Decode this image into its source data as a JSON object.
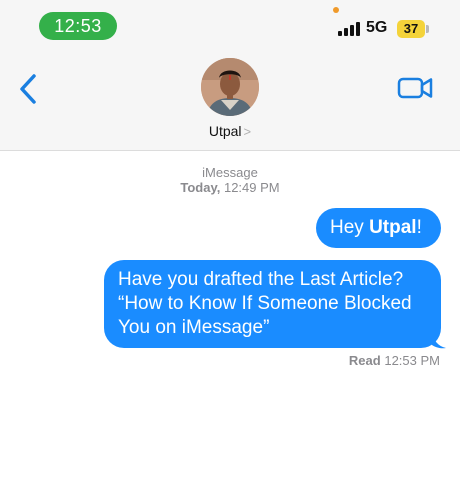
{
  "status_bar": {
    "time": "12:53",
    "network": "5G",
    "battery": "37"
  },
  "nav": {
    "contact_name": "Utpal",
    "chevron": ">"
  },
  "conversation": {
    "service": "iMessage",
    "timestamp_day": "Today,",
    "timestamp_time": "12:49 PM",
    "messages": [
      {
        "prefix": "Hey ",
        "bold": "Utpal",
        "suffix": "!"
      },
      {
        "text": "Have you drafted the Last Article? “How to Know If Someone Blocked You on iMessage”"
      }
    ],
    "read_label": "Read",
    "read_time": "12:53 PM"
  },
  "colors": {
    "bubble": "#1a8cff",
    "accent": "#1a8cff",
    "time_pill": "#34b04a",
    "battery": "#f4d33a"
  },
  "icons": [
    "back-chevron-icon",
    "video-camera-icon",
    "signal-bars-icon",
    "battery-icon"
  ]
}
